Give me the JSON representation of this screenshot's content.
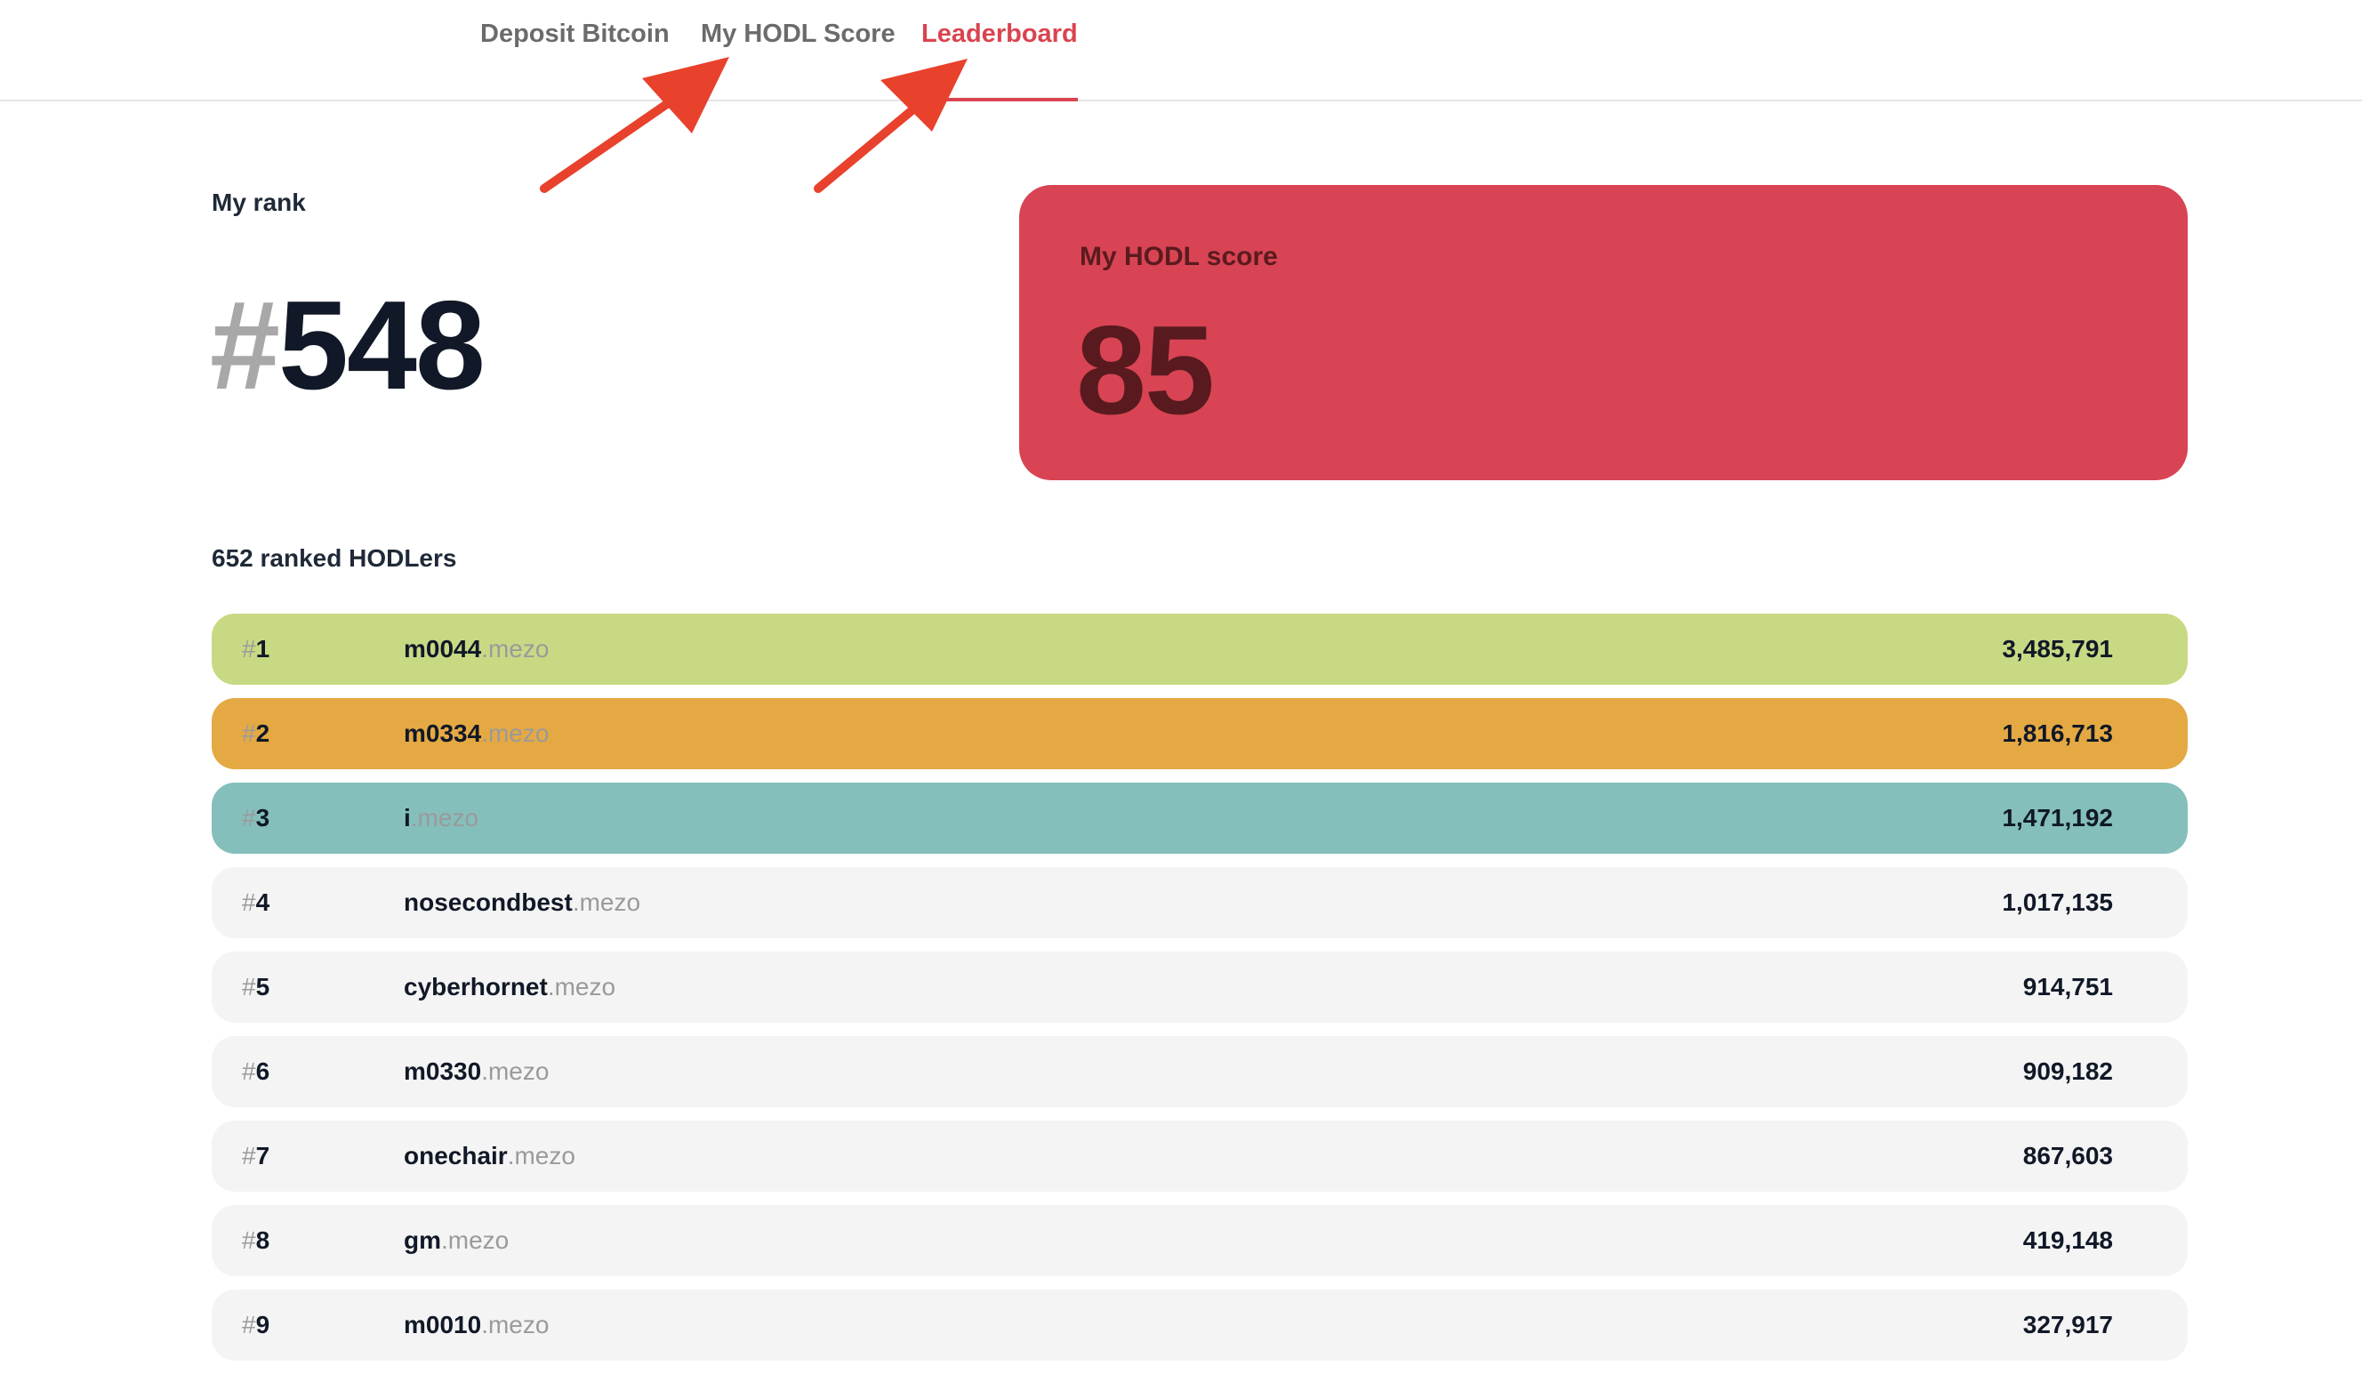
{
  "nav": {
    "tabs": [
      {
        "label": "Deposit Bitcoin",
        "active": false
      },
      {
        "label": "My HODL Score",
        "active": false
      },
      {
        "label": "Leaderboard",
        "active": true
      }
    ]
  },
  "my_rank": {
    "label": "My rank",
    "hash": "#",
    "value": "548"
  },
  "my_score": {
    "label": "My HODL score",
    "value": "85"
  },
  "leaderboard": {
    "count_label": "652 ranked HODLers",
    "rows": [
      {
        "hash": "#",
        "rank": "1",
        "name": "m0044",
        "suffix": ".mezo",
        "score": "3,485,791",
        "color": "#c8d984"
      },
      {
        "hash": "#",
        "rank": "2",
        "name": "m0334",
        "suffix": ".mezo",
        "score": "1,816,713",
        "color": "#e5a943"
      },
      {
        "hash": "#",
        "rank": "3",
        "name": "i",
        "suffix": ".mezo",
        "score": "1,471,192",
        "color": "#84bfbc"
      },
      {
        "hash": "#",
        "rank": "4",
        "name": "nosecondbest",
        "suffix": ".mezo",
        "score": "1,017,135",
        "color": "#f4f4f4"
      },
      {
        "hash": "#",
        "rank": "5",
        "name": "cyberhornet",
        "suffix": ".mezo",
        "score": "914,751",
        "color": "#f4f4f4"
      },
      {
        "hash": "#",
        "rank": "6",
        "name": "m0330",
        "suffix": ".mezo",
        "score": "909,182",
        "color": "#f4f4f4"
      },
      {
        "hash": "#",
        "rank": "7",
        "name": "onechair",
        "suffix": ".mezo",
        "score": "867,603",
        "color": "#f4f4f4"
      },
      {
        "hash": "#",
        "rank": "8",
        "name": "gm",
        "suffix": ".mezo",
        "score": "419,148",
        "color": "#f4f4f4"
      },
      {
        "hash": "#",
        "rank": "9",
        "name": "m0010",
        "suffix": ".mezo",
        "score": "327,917",
        "color": "#f4f4f4"
      }
    ]
  },
  "colors": {
    "accent": "#d9444f",
    "score_card": "#d84453",
    "annotation_arrow": "#e8412c"
  }
}
